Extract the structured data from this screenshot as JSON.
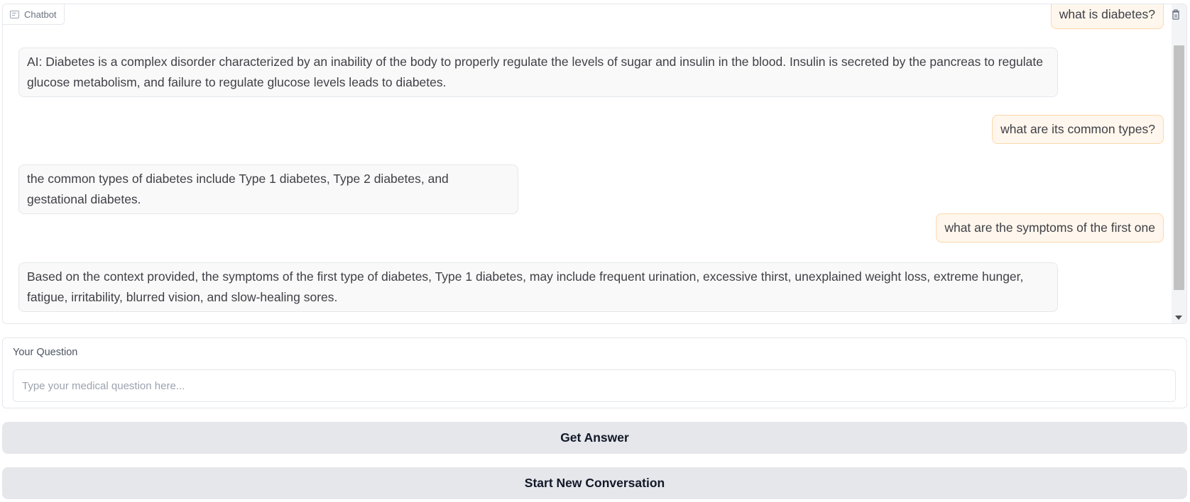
{
  "chatbot": {
    "label": "Chatbot",
    "messages": [
      {
        "role": "user",
        "text": "what is diabetes?"
      },
      {
        "role": "bot",
        "text": "AI: Diabetes is a complex disorder characterized by an inability of the body to properly regulate the levels of sugar and insulin in the blood. Insulin is secreted by the pancreas to regulate glucose metabolism, and failure to regulate glucose levels leads to diabetes."
      },
      {
        "role": "user",
        "text": "what are its common types?"
      },
      {
        "role": "bot",
        "text": "the common types of diabetes include Type 1 diabetes, Type 2 diabetes, and gestational diabetes."
      },
      {
        "role": "user",
        "text": "what are the symptoms of the first one"
      },
      {
        "role": "bot",
        "text": "Based on the context provided, the symptoms of the first type of diabetes, Type 1 diabetes, may include frequent urination, excessive thirst, unexplained weight loss, extreme hunger, fatigue, irritability, blurred vision, and slow-healing sores."
      }
    ],
    "clear_icon": "trash-icon"
  },
  "question": {
    "label": "Your Question",
    "placeholder": "Type your medical question here...",
    "value": ""
  },
  "buttons": {
    "get_answer": "Get Answer",
    "new_conversation": "Start New Conversation"
  },
  "colors": {
    "user_bubble_bg": "#fff7ed",
    "user_bubble_border": "#fed7aa",
    "bot_bubble_bg": "#f9f9f9",
    "button_bg": "#e5e7eb"
  }
}
